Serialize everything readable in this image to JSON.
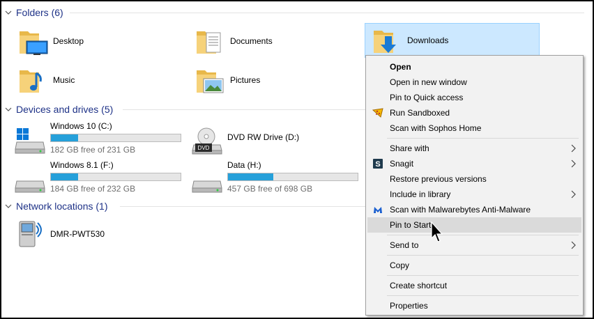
{
  "sections": {
    "folders": "Folders (6)",
    "devices": "Devices and drives (5)",
    "network": "Network locations (1)"
  },
  "folders": {
    "desktop": "Desktop",
    "documents": "Documents",
    "downloads": "Downloads",
    "music": "Music",
    "pictures": "Pictures"
  },
  "drives": [
    {
      "name": "Windows 10 (C:)",
      "free": "182 GB free of 231 GB",
      "used_fraction": 0.21
    },
    {
      "name": "DVD RW Drive (D:)"
    },
    {
      "name": "Windows 8.1 (F:)",
      "free": "184 GB free of 232 GB",
      "used_fraction": 0.21
    },
    {
      "name": "Data (H:)",
      "free": "457 GB free of 698 GB",
      "used_fraction": 0.35
    }
  ],
  "network": {
    "device": "DMR-PWT530"
  },
  "context_menu": {
    "items": [
      {
        "label": "Open",
        "bold": true
      },
      {
        "label": "Open in new window"
      },
      {
        "label": "Pin to Quick access"
      },
      {
        "label": "Run Sandboxed",
        "icon": "sandbox-icon"
      },
      {
        "label": "Scan with Sophos Home"
      },
      {
        "label": "Share with",
        "submenu": true
      },
      {
        "label": "Snagit",
        "icon": "snagit-icon",
        "submenu": true
      },
      {
        "label": "Restore previous versions"
      },
      {
        "label": "Include in library",
        "submenu": true
      },
      {
        "label": "Scan with Malwarebytes Anti-Malware",
        "icon": "malwarebytes-icon"
      },
      {
        "label": "Pin to Start",
        "highlighted": true
      },
      {
        "label": "Send to",
        "submenu": true
      },
      {
        "label": "Copy"
      },
      {
        "label": "Create shortcut"
      },
      {
        "label": "Properties"
      }
    ]
  },
  "colors": {
    "section_header": "#1e3287",
    "selection_bg": "#cce8ff",
    "drive_bar_fill": "#26a0da",
    "menu_bg": "#f2f2f2",
    "menu_hover": "#dadada"
  }
}
